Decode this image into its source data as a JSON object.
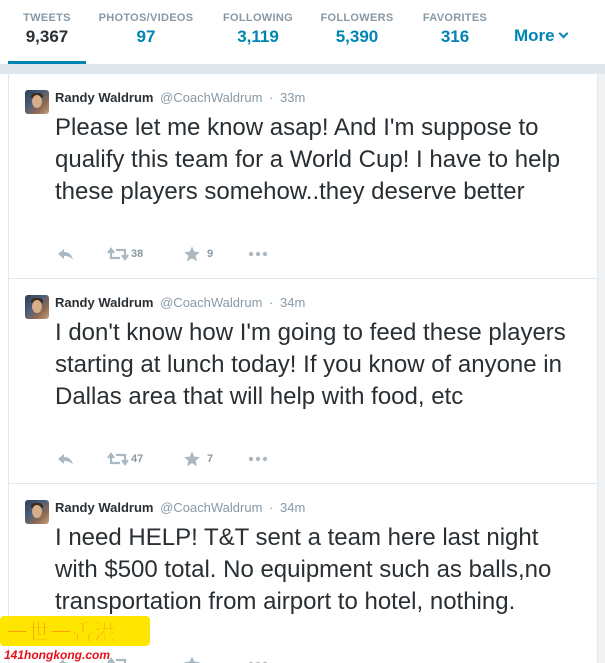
{
  "profile_nav": {
    "stats": [
      {
        "label": "TWEETS",
        "value": "9,367"
      },
      {
        "label": "PHOTOS/VIDEOS",
        "value": "97"
      },
      {
        "label": "FOLLOWING",
        "value": "3,119"
      },
      {
        "label": "FOLLOWERS",
        "value": "5,390"
      },
      {
        "label": "FAVORITES",
        "value": "316"
      }
    ],
    "more_label": "More",
    "active_stat": "TWEETS"
  },
  "tweets": [
    {
      "fullname": "Randy Waldrum",
      "username": "@CoachWaldrum",
      "time": "33m",
      "text": "Please let me know asap!  And I'm suppose to qualify this team for a World Cup! I have to help these players somehow..they deserve better",
      "retweets": "38",
      "favorites": "9"
    },
    {
      "fullname": "Randy Waldrum",
      "username": "@CoachWaldrum",
      "time": "34m",
      "text": "I don't know how I'm going to feed these players starting at lunch today! If you know of anyone in Dallas area that will help with food, etc",
      "retweets": "47",
      "favorites": "7"
    },
    {
      "fullname": "Randy Waldrum",
      "username": "@CoachWaldrum",
      "time": "34m",
      "text": "I need HELP! T&T sent a team here last night with $500 total.  No equipment such as balls,no transportation from airport to hotel, nothing.",
      "retweets": "",
      "favorites": ""
    }
  ],
  "icons": {
    "reply": "reply-icon",
    "retweet": "retweet-icon",
    "favorite": "star-icon",
    "more": "ellipsis-icon",
    "more_nav": "chevron-down-icon"
  },
  "watermark": {
    "line1": "一世一香港",
    "line2": "141hongkong.com"
  },
  "colors": {
    "link": "#0084b4",
    "muted": "#8899a6",
    "text": "#292f33",
    "border": "#e1e8ed",
    "watermark_red": "#e8111b",
    "watermark_yellow": "#ffe600"
  }
}
